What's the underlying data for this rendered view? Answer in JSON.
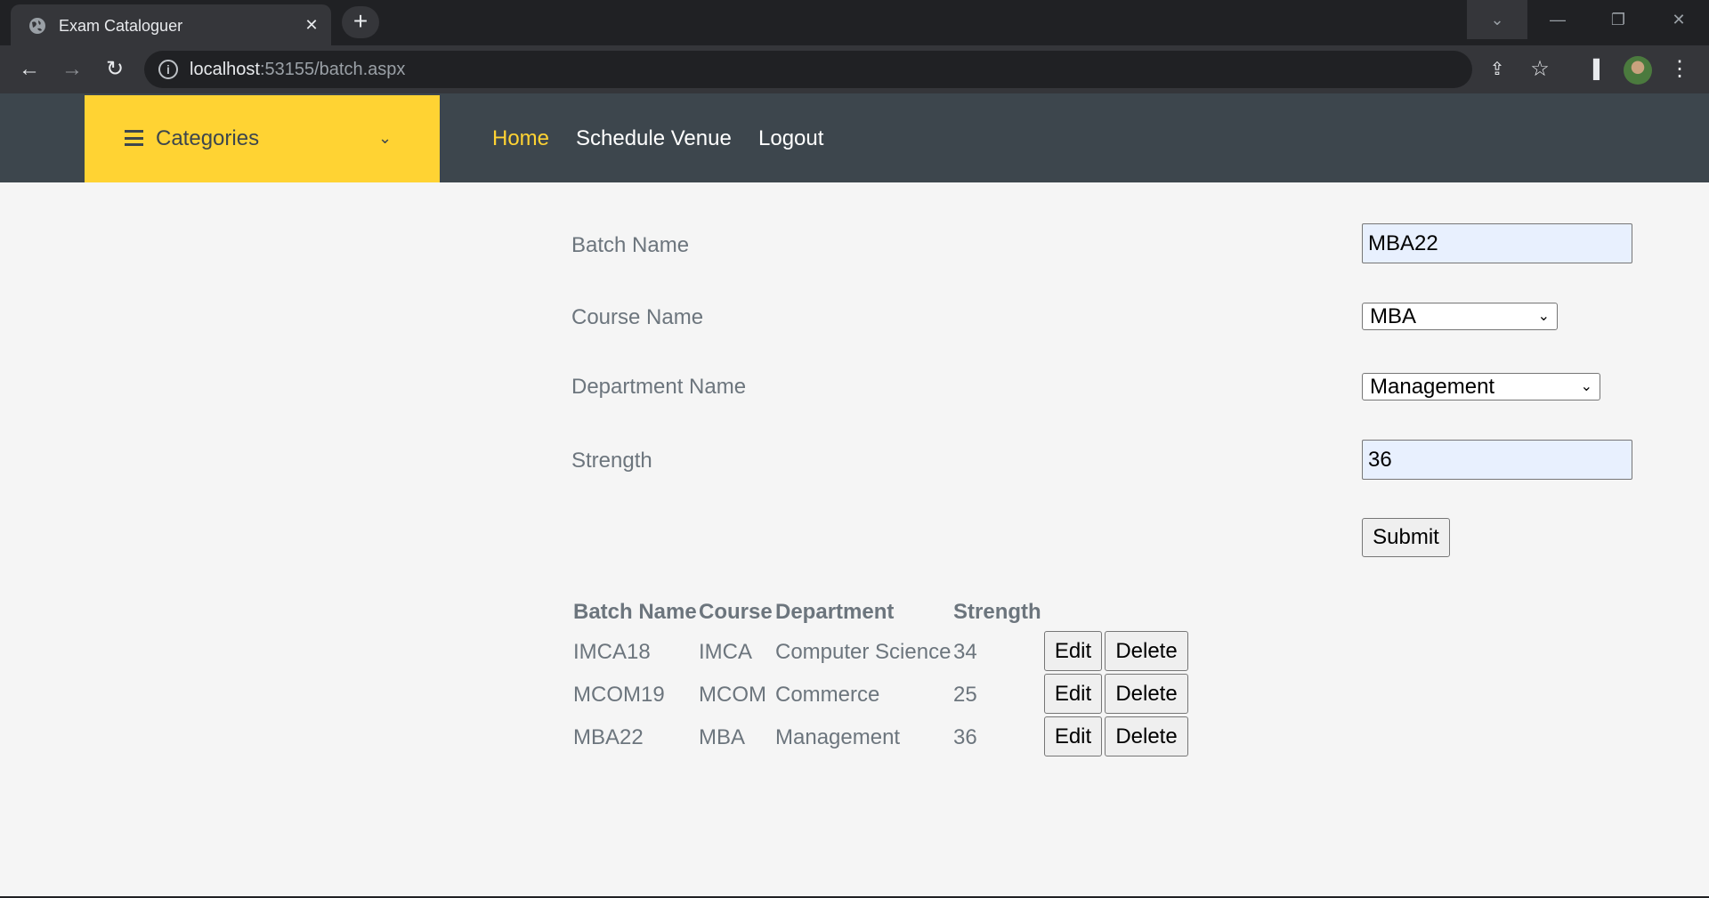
{
  "browser": {
    "tab_title": "Exam Cataloguer",
    "url_host": "localhost",
    "url_rest": ":53155/batch.aspx"
  },
  "nav": {
    "categories_label": "Categories",
    "links": [
      "Home",
      "Schedule Venue",
      "Logout"
    ]
  },
  "form": {
    "batch_name_label": "Batch Name",
    "batch_name_value": "MBA22",
    "course_name_label": "Course Name",
    "course_name_value": "MBA",
    "department_name_label": "Department Name",
    "department_name_value": "Management",
    "strength_label": "Strength",
    "strength_value": "36",
    "submit_label": "Submit"
  },
  "table": {
    "headers": [
      "Batch Name",
      "Course",
      "Department",
      "Strength"
    ],
    "rows": [
      {
        "batch": "IMCA18",
        "course": "IMCA",
        "department": "Computer Science",
        "strength": "34"
      },
      {
        "batch": "MCOM19",
        "course": "MCOM",
        "department": "Commerce",
        "strength": "25"
      },
      {
        "batch": "MBA22",
        "course": "MBA",
        "department": "Management",
        "strength": "36"
      }
    ],
    "edit_label": "Edit",
    "delete_label": "Delete"
  }
}
